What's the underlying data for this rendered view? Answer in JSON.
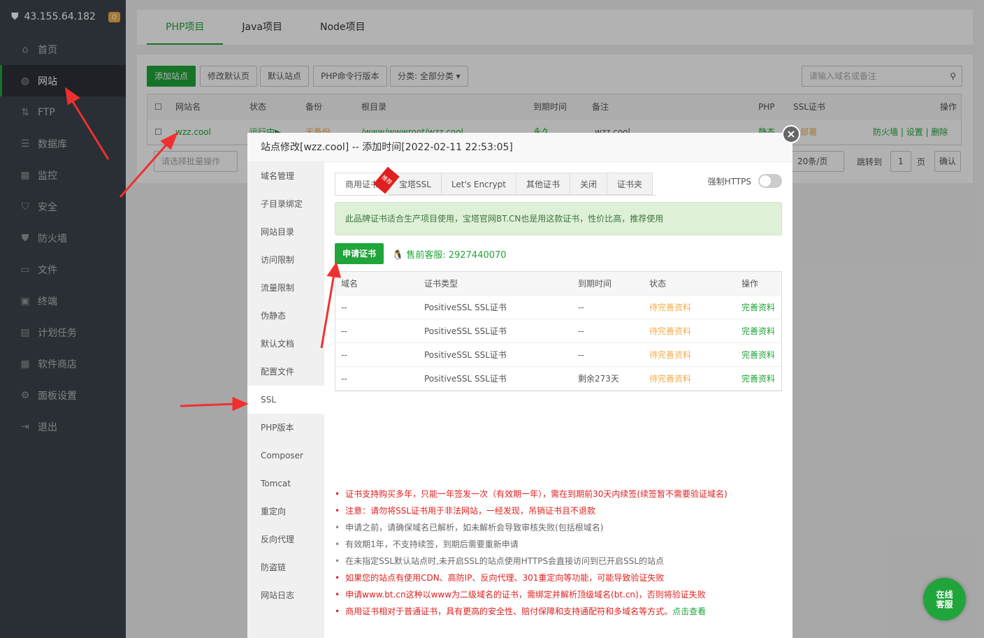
{
  "sidebar": {
    "ip": "43.155.64.182",
    "badge": "0",
    "items": [
      {
        "label": "首页",
        "icon": "home-icon"
      },
      {
        "label": "网站",
        "icon": "globe-icon"
      },
      {
        "label": "FTP",
        "icon": "ftp-icon"
      },
      {
        "label": "数据库",
        "icon": "database-icon"
      },
      {
        "label": "监控",
        "icon": "monitor-icon"
      },
      {
        "label": "安全",
        "icon": "shield-icon"
      },
      {
        "label": "防火墙",
        "icon": "firewall-icon"
      },
      {
        "label": "文件",
        "icon": "folder-icon"
      },
      {
        "label": "终端",
        "icon": "terminal-icon"
      },
      {
        "label": "计划任务",
        "icon": "calendar-icon"
      },
      {
        "label": "软件商店",
        "icon": "grid-icon"
      },
      {
        "label": "面板设置",
        "icon": "gear-icon"
      },
      {
        "label": "退出",
        "icon": "logout-icon"
      }
    ]
  },
  "project_tabs": [
    "PHP项目",
    "Java项目",
    "Node项目"
  ],
  "toolbar": {
    "add": "添加站点",
    "modify_default": "修改默认页",
    "default_site": "默认站点",
    "php_cli": "PHP命令行版本",
    "category": "分类: 全部分类",
    "search_placeholder": "请输入域名或备注"
  },
  "sites_table": {
    "headers": [
      "网站名",
      "状态",
      "备份",
      "根目录",
      "到期时间",
      "备注",
      "PHP",
      "SSL证书",
      "操作"
    ],
    "row": {
      "name": "wzz.cool",
      "status": "运行中▶",
      "backup": "无备份",
      "root": "/www/wwwroot/wzz.cool",
      "expire": "永久",
      "note": "wzz.cool",
      "php": "静态",
      "ssl": "部署",
      "actions": [
        "防火墙",
        "设置",
        "删除"
      ]
    }
  },
  "pagination": {
    "batch_placeholder": "请选择批量操作",
    "per_page": "20条/页",
    "goto": "跳转到",
    "page": "1",
    "page_unit": "页",
    "confirm": "确认"
  },
  "modal": {
    "title": "站点修改[wzz.cool] -- 添加时间[2022-02-11 22:53:05]",
    "nav": [
      "域名管理",
      "子目录绑定",
      "网站目录",
      "访问限制",
      "流量限制",
      "伪静态",
      "默认文档",
      "配置文件",
      "SSL",
      "PHP版本",
      "Composer",
      "Tomcat",
      "重定向",
      "反向代理",
      "防盗链",
      "网站日志"
    ],
    "ssl_tabs": [
      "商用证书",
      "宝塔SSL",
      "Let's Encrypt",
      "其他证书",
      "关闭",
      "证书夹"
    ],
    "ribbon": "推荐",
    "force_https": "强制HTTPS",
    "force_https_on": false,
    "alert": "此品牌证书适合生产项目使用，宝塔官网BT.CN也是用这款证书，性价比高，推荐使用",
    "apply_button": "申请证书",
    "service": "售前客服: 2927440070",
    "cert_headers": [
      "域名",
      "证书类型",
      "到期时间",
      "状态",
      "操作"
    ],
    "cert_rows": [
      {
        "domain": "--",
        "type": "PositiveSSL SSL证书",
        "expire": "--",
        "status": "待完善资料",
        "action": "完善资料"
      },
      {
        "domain": "--",
        "type": "PositiveSSL SSL证书",
        "expire": "--",
        "status": "待完善资料",
        "action": "完善资料"
      },
      {
        "domain": "--",
        "type": "PositiveSSL SSL证书",
        "expire": "--",
        "status": "待完善资料",
        "action": "完善资料"
      },
      {
        "domain": "--",
        "type": "PositiveSSL SSL证书",
        "expire": "剩余273天",
        "status": "待完善资料",
        "action": "完善资料"
      }
    ],
    "notes": [
      {
        "text": "证书支持购买多年，只能一年签发一次（有效期一年），需在到期前30天内续签(续签暂不需要验证域名)",
        "red": true
      },
      {
        "text": "注意：请勿将SSL证书用于非法网站，一经发现，吊销证书且不退款",
        "red": true
      },
      {
        "text": "申请之前，请确保域名已解析，如未解析会导致审核失败(包括根域名)",
        "red": false
      },
      {
        "text": "有效期1年，不支持续签，到期后需要重新申请",
        "red": false
      },
      {
        "text": "在未指定SSL默认站点时,未开启SSL的站点使用HTTPS会直接访问到已开启SSL的站点",
        "red": false
      },
      {
        "text": "如果您的站点有使用CDN、高防IP、反向代理、301重定向等功能，可能导致验证失败",
        "red": true
      },
      {
        "text": "申请www.bt.cn这种以www为二级域名的证书，需绑定并解析顶级域名(bt.cn)，否则将验证失败",
        "red": true
      },
      {
        "text": "商用证书相对于普通证书，具有更高的安全性、赔付保障和支持通配符和多域名等方式。",
        "red": true,
        "link": "点击查看"
      }
    ]
  },
  "chat": {
    "line1": "在线",
    "line2": "客服"
  },
  "colors": {
    "brand": "#20a53a",
    "warning": "#f0ad4e",
    "danger": "#e02020"
  }
}
